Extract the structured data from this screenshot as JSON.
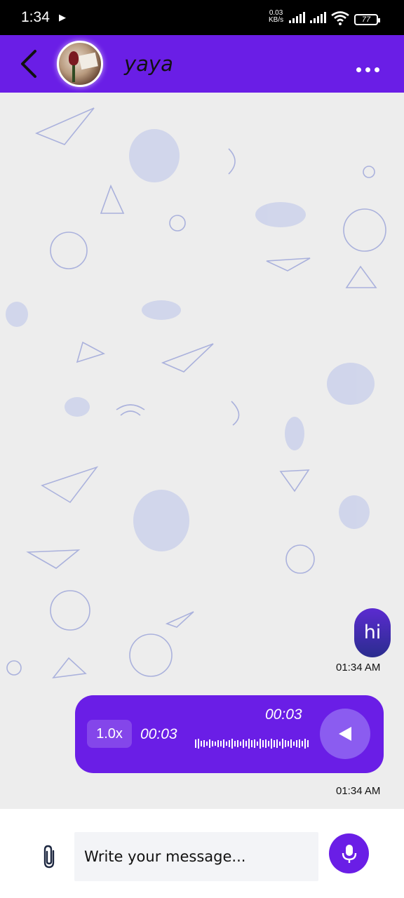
{
  "status_bar": {
    "time": "1:34",
    "speed_top": "0.03",
    "speed_bottom": "KB/s",
    "battery": "77"
  },
  "header": {
    "back_icon": "chevron-left-icon",
    "contact_name": "yaya",
    "more_icon": "more-horizontal-icon"
  },
  "messages": [
    {
      "type": "text",
      "text": "hi",
      "time": "01:34 AM"
    },
    {
      "type": "voice",
      "playback_rate": "1.0x",
      "current_time": "00:03",
      "total_time": "00:03",
      "time": "01:34 AM"
    }
  ],
  "composer": {
    "attach_icon": "paperclip-icon",
    "placeholder": "Write your message...",
    "mic_icon": "microphone-icon"
  },
  "colors": {
    "accent": "#6a1ee6",
    "bubble_gradient_top": "#5b2bd0",
    "bubble_gradient_bottom": "#2a2c8e"
  }
}
